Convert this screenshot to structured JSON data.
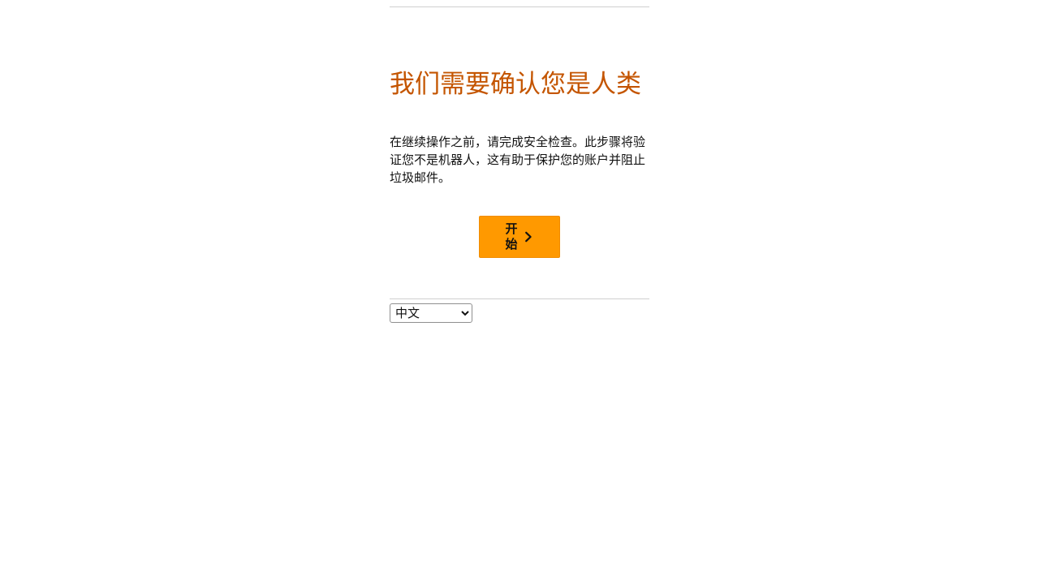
{
  "page": {
    "title": "我们需要确认您是人类",
    "description": "在继续操作之前，请完成安全检查。此步骤将验证您不是机器人，这有助于保护您的账户并阻止垃圾邮件。"
  },
  "actions": {
    "start_label": "开始",
    "start_icon": "chevron-right-icon"
  },
  "language": {
    "selected": "中文",
    "options": [
      "中文"
    ]
  },
  "colors": {
    "title": "#c45500",
    "button": "#ff9900",
    "divider": "#cfcfcf"
  }
}
